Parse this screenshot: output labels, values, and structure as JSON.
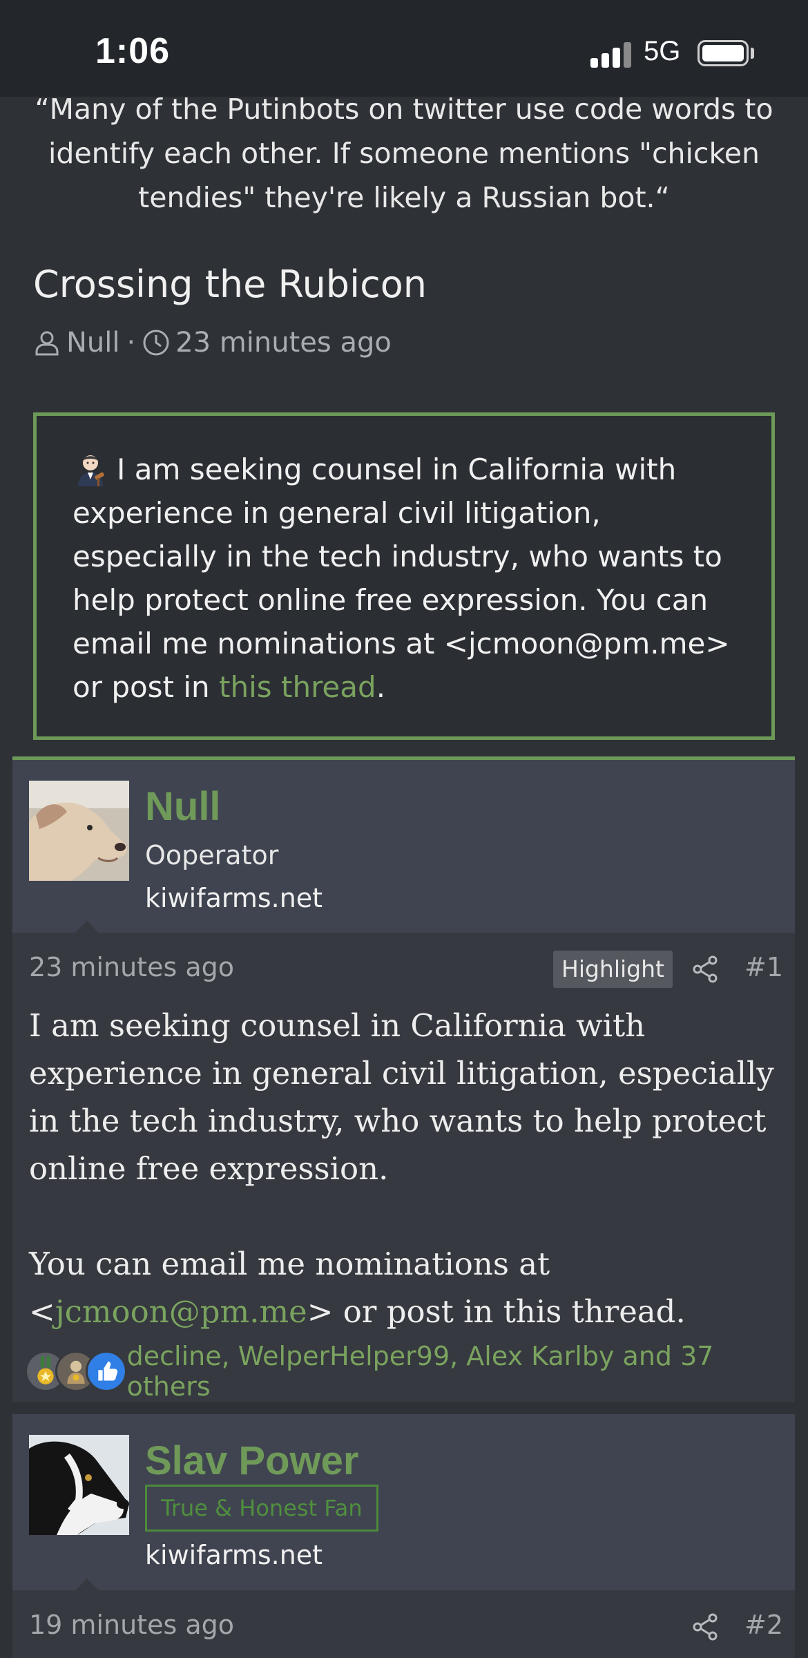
{
  "status_bar": {
    "time": "1:06",
    "network": "5G"
  },
  "quote": {
    "text": "“Many of the Putinbots on twitter use code words to identify each other. If someone mentions \"chicken tendies\" they're likely a Russian bot.“"
  },
  "thread": {
    "title": "Crossing the Rubicon",
    "author": "Null",
    "separator": "·",
    "time": "23 minutes ago"
  },
  "notice": {
    "text_before_link": "I am seeking counsel in California with experience in general civil litigation, especially in the tech industry, who wants to help protect online free expression. You can email me nominations at <jcmoon@pm.me> or post in ",
    "link_text": "this thread",
    "text_after_link": ".",
    "accent_color": "#6d9a58"
  },
  "posts": [
    {
      "username": "Null",
      "user_title": "Ooperator",
      "site": "kiwifarms.net",
      "time": "23 minutes ago",
      "highlight_label": "Highlight",
      "number": "#1",
      "body_paragraph_1": "I am seeking counsel in California with experience in general civil litigation, especially in the tech industry, who wants to help protect online free expression.",
      "body_p2_before": "You can email me nominations at <",
      "body_p2_link": "jcmoon@pm.me",
      "body_p2_after": "> or post in this thread.",
      "reactions_text": "decline, WelperHelper99, Alex Karlby and 37 others"
    },
    {
      "username": "Slav Power",
      "user_banner": "True & Honest Fan",
      "site": "kiwifarms.net",
      "time": "19 minutes ago",
      "number": "#2"
    }
  ],
  "colors": {
    "background": "#2e3136",
    "post_header": "#404450",
    "username_green": "#6f9a59",
    "link_green": "#7aa35f"
  }
}
